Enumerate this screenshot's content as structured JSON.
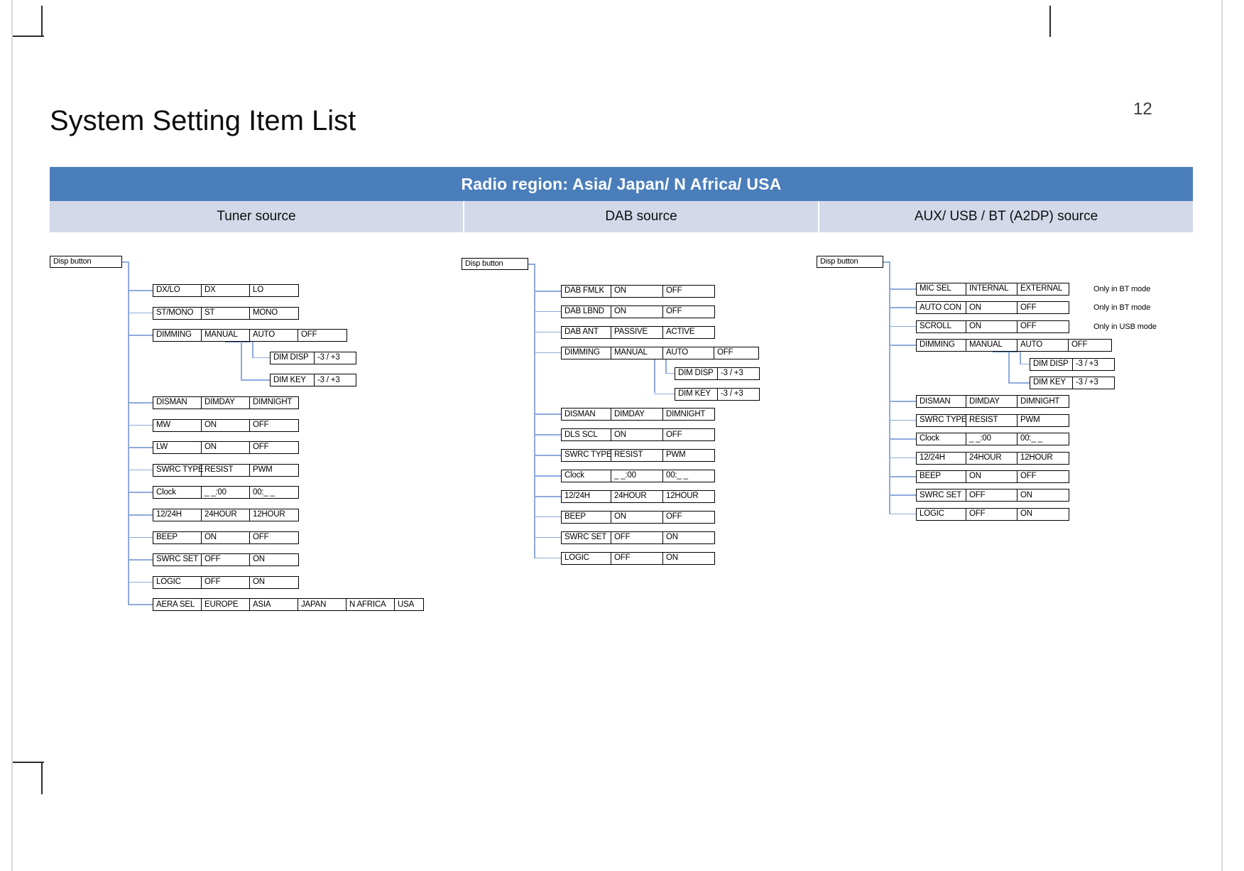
{
  "page": {
    "title": "System Setting Item List",
    "number": "12"
  },
  "table": {
    "region_header": "Radio region: Asia/ Japan/ N Africa/ USA",
    "sources": [
      "Tuner source",
      "DAB source",
      "AUX/ USB / BT (A2DP) source"
    ]
  },
  "colors": {
    "band_blue": "#4a7ebb",
    "source_row": "#d3d9e9",
    "connector": "#8eaadb"
  },
  "trees": [
    {
      "id": "tuner",
      "root": "Disp button",
      "items": [
        {
          "cells": [
            "DX/LO",
            "DX",
            "LO"
          ]
        },
        {
          "cells": [
            "ST/MONO",
            "ST",
            "MONO"
          ]
        },
        {
          "cells": [
            "DIMMING",
            "MANUAL",
            "AUTO",
            "OFF"
          ]
        },
        {
          "cells": [
            "DIM DISP",
            "-3 / +3"
          ],
          "sub": true
        },
        {
          "cells": [
            "DIM KEY",
            "-3 / +3"
          ],
          "sub": true
        },
        {
          "cells": [
            "DISMAN",
            "DIMDAY",
            "DIMNIGHT"
          ]
        },
        {
          "cells": [
            "MW",
            "ON",
            "OFF"
          ]
        },
        {
          "cells": [
            "LW",
            "ON",
            "OFF"
          ]
        },
        {
          "cells": [
            "SWRC TYPE",
            "RESIST",
            "PWM"
          ]
        },
        {
          "cells": [
            "Clock",
            "_ _:00",
            "00:_ _"
          ]
        },
        {
          "cells": [
            "12/24H",
            "24HOUR",
            "12HOUR"
          ]
        },
        {
          "cells": [
            "BEEP",
            "ON",
            "OFF"
          ]
        },
        {
          "cells": [
            "SWRC SET",
            "OFF",
            "ON"
          ]
        },
        {
          "cells": [
            "LOGIC",
            "OFF",
            "ON"
          ]
        },
        {
          "cells": [
            "AERA SEL",
            "EUROPE",
            "ASIA",
            "JAPAN",
            "N AFRICA",
            "USA"
          ]
        }
      ]
    },
    {
      "id": "dab",
      "root": "Disp button",
      "items": [
        {
          "cells": [
            "DAB FMLK",
            "ON",
            "OFF"
          ]
        },
        {
          "cells": [
            "DAB  LBND",
            "ON",
            "OFF"
          ]
        },
        {
          "cells": [
            "DAB ANT",
            "PASSIVE",
            "ACTIVE"
          ]
        },
        {
          "cells": [
            "DIMMING",
            "MANUAL",
            "AUTO",
            "OFF"
          ]
        },
        {
          "cells": [
            "DIM DISP",
            "-3 / +3"
          ],
          "sub": true
        },
        {
          "cells": [
            "DIM KEY",
            "-3 / +3"
          ],
          "sub": true
        },
        {
          "cells": [
            "DISMAN",
            "DIMDAY",
            "DIMNIGHT"
          ]
        },
        {
          "cells": [
            "DLS SCL",
            "ON",
            "OFF"
          ]
        },
        {
          "cells": [
            "SWRC TYPE",
            "RESIST",
            "PWM"
          ]
        },
        {
          "cells": [
            "Clock",
            "_ _:00",
            "00:_ _"
          ]
        },
        {
          "cells": [
            "12/24H",
            "24HOUR",
            "12HOUR"
          ]
        },
        {
          "cells": [
            "BEEP",
            "ON",
            "OFF"
          ]
        },
        {
          "cells": [
            "SWRC SET",
            "OFF",
            "ON"
          ]
        },
        {
          "cells": [
            "LOGIC",
            "OFF",
            "ON"
          ]
        }
      ]
    },
    {
      "id": "aux",
      "root": "Disp button",
      "items": [
        {
          "cells": [
            "MIC SEL",
            "INTERNAL",
            "EXTERNAL"
          ],
          "note": "Only in BT mode"
        },
        {
          "cells": [
            "AUTO CON",
            "ON",
            "OFF"
          ],
          "note": "Only in BT mode"
        },
        {
          "cells": [
            "SCROLL",
            "ON",
            "OFF"
          ],
          "note": "Only in USB mode"
        },
        {
          "cells": [
            "DIMMING",
            "MANUAL",
            "AUTO",
            "OFF"
          ]
        },
        {
          "cells": [
            "DIM DISP",
            "-3 / +3"
          ],
          "sub": true
        },
        {
          "cells": [
            "DIM KEY",
            "-3 / +3"
          ],
          "sub": true
        },
        {
          "cells": [
            "DISMAN",
            "DIMDAY",
            "DIMNIGHT"
          ]
        },
        {
          "cells": [
            "SWRC TYPE",
            "RESIST",
            "PWM"
          ]
        },
        {
          "cells": [
            "Clock",
            "_ _:00",
            "00:_ _"
          ]
        },
        {
          "cells": [
            "12/24H",
            "24HOUR",
            "12HOUR"
          ]
        },
        {
          "cells": [
            "BEEP",
            "ON",
            "OFF"
          ]
        },
        {
          "cells": [
            "SWRC SET",
            "OFF",
            "ON"
          ]
        },
        {
          "cells": [
            "LOGIC",
            "OFF",
            "ON"
          ]
        }
      ]
    }
  ]
}
